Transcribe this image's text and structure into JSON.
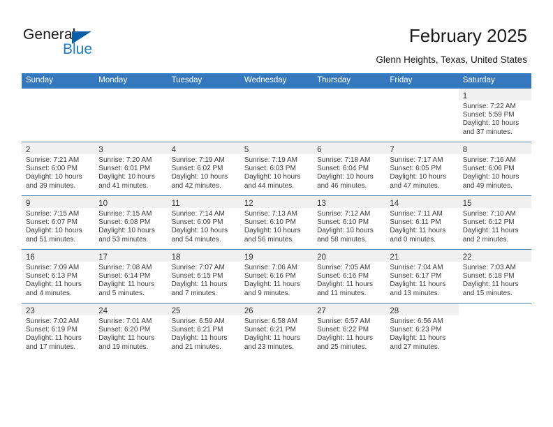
{
  "brand": {
    "name_part1": "General",
    "name_part2": "Blue",
    "triangle_color": "#0b5ea8",
    "blue_color": "#1d7ac4"
  },
  "header": {
    "title": "February 2025",
    "subtitle": "Glenn Heights, Texas, United States",
    "header_bg": "#3578bd",
    "header_text": "#ffffff"
  },
  "weekdays": [
    "Sunday",
    "Monday",
    "Tuesday",
    "Wednesday",
    "Thursday",
    "Friday",
    "Saturday"
  ],
  "labels": {
    "sunrise": "Sunrise:",
    "sunset": "Sunset:",
    "daylight": "Daylight:"
  },
  "weeks": [
    [
      {
        "empty": true
      },
      {
        "empty": true
      },
      {
        "empty": true
      },
      {
        "empty": true
      },
      {
        "empty": true
      },
      {
        "empty": true
      },
      {
        "day": "1",
        "sunrise": "Sunrise: 7:22 AM",
        "sunset": "Sunset: 5:59 PM",
        "daylight1": "Daylight: 10 hours",
        "daylight2": "and 37 minutes."
      }
    ],
    [
      {
        "day": "2",
        "sunrise": "Sunrise: 7:21 AM",
        "sunset": "Sunset: 6:00 PM",
        "daylight1": "Daylight: 10 hours",
        "daylight2": "and 39 minutes."
      },
      {
        "day": "3",
        "sunrise": "Sunrise: 7:20 AM",
        "sunset": "Sunset: 6:01 PM",
        "daylight1": "Daylight: 10 hours",
        "daylight2": "and 41 minutes."
      },
      {
        "day": "4",
        "sunrise": "Sunrise: 7:19 AM",
        "sunset": "Sunset: 6:02 PM",
        "daylight1": "Daylight: 10 hours",
        "daylight2": "and 42 minutes."
      },
      {
        "day": "5",
        "sunrise": "Sunrise: 7:19 AM",
        "sunset": "Sunset: 6:03 PM",
        "daylight1": "Daylight: 10 hours",
        "daylight2": "and 44 minutes."
      },
      {
        "day": "6",
        "sunrise": "Sunrise: 7:18 AM",
        "sunset": "Sunset: 6:04 PM",
        "daylight1": "Daylight: 10 hours",
        "daylight2": "and 46 minutes."
      },
      {
        "day": "7",
        "sunrise": "Sunrise: 7:17 AM",
        "sunset": "Sunset: 6:05 PM",
        "daylight1": "Daylight: 10 hours",
        "daylight2": "and 47 minutes."
      },
      {
        "day": "8",
        "sunrise": "Sunrise: 7:16 AM",
        "sunset": "Sunset: 6:06 PM",
        "daylight1": "Daylight: 10 hours",
        "daylight2": "and 49 minutes."
      }
    ],
    [
      {
        "day": "9",
        "sunrise": "Sunrise: 7:15 AM",
        "sunset": "Sunset: 6:07 PM",
        "daylight1": "Daylight: 10 hours",
        "daylight2": "and 51 minutes."
      },
      {
        "day": "10",
        "sunrise": "Sunrise: 7:15 AM",
        "sunset": "Sunset: 6:08 PM",
        "daylight1": "Daylight: 10 hours",
        "daylight2": "and 53 minutes."
      },
      {
        "day": "11",
        "sunrise": "Sunrise: 7:14 AM",
        "sunset": "Sunset: 6:09 PM",
        "daylight1": "Daylight: 10 hours",
        "daylight2": "and 54 minutes."
      },
      {
        "day": "12",
        "sunrise": "Sunrise: 7:13 AM",
        "sunset": "Sunset: 6:10 PM",
        "daylight1": "Daylight: 10 hours",
        "daylight2": "and 56 minutes."
      },
      {
        "day": "13",
        "sunrise": "Sunrise: 7:12 AM",
        "sunset": "Sunset: 6:10 PM",
        "daylight1": "Daylight: 10 hours",
        "daylight2": "and 58 minutes."
      },
      {
        "day": "14",
        "sunrise": "Sunrise: 7:11 AM",
        "sunset": "Sunset: 6:11 PM",
        "daylight1": "Daylight: 11 hours",
        "daylight2": "and 0 minutes."
      },
      {
        "day": "15",
        "sunrise": "Sunrise: 7:10 AM",
        "sunset": "Sunset: 6:12 PM",
        "daylight1": "Daylight: 11 hours",
        "daylight2": "and 2 minutes."
      }
    ],
    [
      {
        "day": "16",
        "sunrise": "Sunrise: 7:09 AM",
        "sunset": "Sunset: 6:13 PM",
        "daylight1": "Daylight: 11 hours",
        "daylight2": "and 4 minutes."
      },
      {
        "day": "17",
        "sunrise": "Sunrise: 7:08 AM",
        "sunset": "Sunset: 6:14 PM",
        "daylight1": "Daylight: 11 hours",
        "daylight2": "and 5 minutes."
      },
      {
        "day": "18",
        "sunrise": "Sunrise: 7:07 AM",
        "sunset": "Sunset: 6:15 PM",
        "daylight1": "Daylight: 11 hours",
        "daylight2": "and 7 minutes."
      },
      {
        "day": "19",
        "sunrise": "Sunrise: 7:06 AM",
        "sunset": "Sunset: 6:16 PM",
        "daylight1": "Daylight: 11 hours",
        "daylight2": "and 9 minutes."
      },
      {
        "day": "20",
        "sunrise": "Sunrise: 7:05 AM",
        "sunset": "Sunset: 6:16 PM",
        "daylight1": "Daylight: 11 hours",
        "daylight2": "and 11 minutes."
      },
      {
        "day": "21",
        "sunrise": "Sunrise: 7:04 AM",
        "sunset": "Sunset: 6:17 PM",
        "daylight1": "Daylight: 11 hours",
        "daylight2": "and 13 minutes."
      },
      {
        "day": "22",
        "sunrise": "Sunrise: 7:03 AM",
        "sunset": "Sunset: 6:18 PM",
        "daylight1": "Daylight: 11 hours",
        "daylight2": "and 15 minutes."
      }
    ],
    [
      {
        "day": "23",
        "sunrise": "Sunrise: 7:02 AM",
        "sunset": "Sunset: 6:19 PM",
        "daylight1": "Daylight: 11 hours",
        "daylight2": "and 17 minutes."
      },
      {
        "day": "24",
        "sunrise": "Sunrise: 7:01 AM",
        "sunset": "Sunset: 6:20 PM",
        "daylight1": "Daylight: 11 hours",
        "daylight2": "and 19 minutes."
      },
      {
        "day": "25",
        "sunrise": "Sunrise: 6:59 AM",
        "sunset": "Sunset: 6:21 PM",
        "daylight1": "Daylight: 11 hours",
        "daylight2": "and 21 minutes."
      },
      {
        "day": "26",
        "sunrise": "Sunrise: 6:58 AM",
        "sunset": "Sunset: 6:21 PM",
        "daylight1": "Daylight: 11 hours",
        "daylight2": "and 23 minutes."
      },
      {
        "day": "27",
        "sunrise": "Sunrise: 6:57 AM",
        "sunset": "Sunset: 6:22 PM",
        "daylight1": "Daylight: 11 hours",
        "daylight2": "and 25 minutes."
      },
      {
        "day": "28",
        "sunrise": "Sunrise: 6:56 AM",
        "sunset": "Sunset: 6:23 PM",
        "daylight1": "Daylight: 11 hours",
        "daylight2": "and 27 minutes."
      },
      {
        "empty": true
      }
    ]
  ]
}
